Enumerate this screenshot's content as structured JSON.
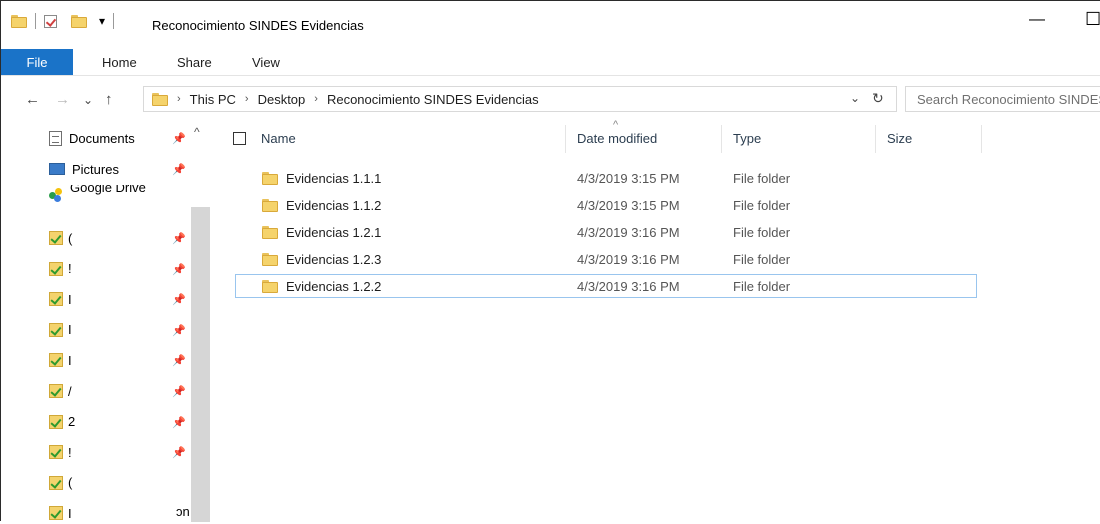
{
  "window": {
    "title": "Reconocimiento SINDES Evidencias",
    "minimize_glyph": "—",
    "maximize_glyph": "☐",
    "qa_dropdown_glyph": "▾"
  },
  "ribbon": {
    "file": "File",
    "tabs": [
      "Home",
      "Share",
      "View"
    ]
  },
  "nav": {
    "back": "←",
    "forward": "→",
    "recent": "⌄",
    "up": "↑",
    "refresh": "↻",
    "dropdown": "⌄"
  },
  "address": {
    "breadcrumb": [
      "This PC",
      "Desktop",
      "Reconocimiento SINDES Evidencias"
    ],
    "separator": "›"
  },
  "search": {
    "placeholder": "Search Reconocimiento SINDES Evidencias"
  },
  "navpane": {
    "pin_glyph": "📌",
    "scroll_up": "^",
    "items": [
      {
        "label": "Documents",
        "icon": "documents-icon"
      },
      {
        "label": "Pictures",
        "icon": "pictures-icon"
      },
      {
        "label": "Google Drive",
        "icon": "google-drive-icon"
      }
    ],
    "checked_fragments": [
      "(",
      "!",
      "I",
      "I",
      "I",
      "/",
      "2",
      "!",
      "(",
      "I"
    ],
    "tail_text": "ɔn"
  },
  "columns": {
    "name": "Name",
    "date": "Date modified",
    "type": "Type",
    "size": "Size",
    "sort_glyph": "^"
  },
  "files": [
    {
      "name": "Evidencias 1.1.1",
      "date": "4/3/2019 3:15 PM",
      "type": "File folder"
    },
    {
      "name": "Evidencias 1.1.2",
      "date": "4/3/2019 3:15 PM",
      "type": "File folder"
    },
    {
      "name": "Evidencias 1.2.1",
      "date": "4/3/2019 3:16 PM",
      "type": "File folder"
    },
    {
      "name": "Evidencias 1.2.3",
      "date": "4/3/2019 3:16 PM",
      "type": "File folder"
    },
    {
      "name": "Evidencias 1.2.2",
      "date": "4/3/2019 3:16 PM",
      "type": "File folder"
    }
  ]
}
